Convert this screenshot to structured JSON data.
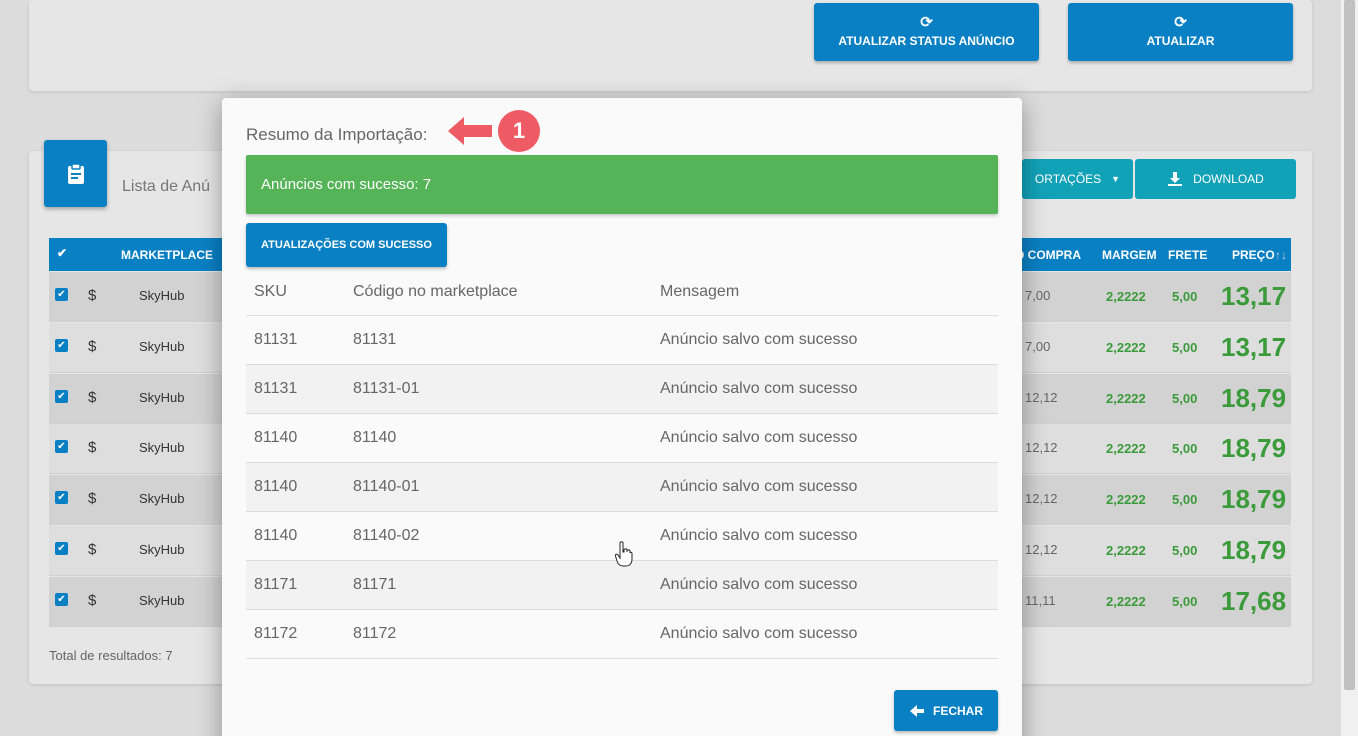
{
  "top_buttons": {
    "update_status_label": "ATUALIZAR STATUS ANÚNCIO",
    "update_label": "ATUALIZAR"
  },
  "list": {
    "title": "Lista de Anú",
    "importations_label": "ORTAÇÕES",
    "download_label": "DOWNLOAD",
    "columns": {
      "marketplace": "MARKETPLACE",
      "compra": "O COMPRA",
      "margem": "MARGEM",
      "frete": "FRETE",
      "preco": "PREÇO"
    },
    "rows": [
      {
        "marketplace": "SkyHub",
        "compra": "7,00",
        "margem": "2,2222",
        "frete": "5,00",
        "preco": "13,17"
      },
      {
        "marketplace": "SkyHub",
        "compra": "7,00",
        "margem": "2,2222",
        "frete": "5,00",
        "preco": "13,17"
      },
      {
        "marketplace": "SkyHub",
        "compra": "12,12",
        "margem": "2,2222",
        "frete": "5,00",
        "preco": "18,79"
      },
      {
        "marketplace": "SkyHub",
        "compra": "12,12",
        "margem": "2,2222",
        "frete": "5,00",
        "preco": "18,79"
      },
      {
        "marketplace": "SkyHub",
        "compra": "12,12",
        "margem": "2,2222",
        "frete": "5,00",
        "preco": "18,79"
      },
      {
        "marketplace": "SkyHub",
        "compra": "12,12",
        "margem": "2,2222",
        "frete": "5,00",
        "preco": "18,79"
      },
      {
        "marketplace": "SkyHub",
        "compra": "11,11",
        "margem": "2,2222",
        "frete": "5,00",
        "preco": "17,68"
      }
    ],
    "total": "Total de resultados: 7"
  },
  "modal": {
    "title": "Resumo da Importação:",
    "annotation_number": "1",
    "alert": "Anúncios com sucesso: 7",
    "success_button": "ATUALIZAÇÕES COM SUCESSO",
    "columns": {
      "sku": "SKU",
      "code": "Código no marketplace",
      "message": "Mensagem"
    },
    "rows": [
      {
        "sku": "81131",
        "code": "81131",
        "message": "Anúncio salvo com sucesso"
      },
      {
        "sku": "81131",
        "code": "81131-01",
        "message": "Anúncio salvo com sucesso"
      },
      {
        "sku": "81140",
        "code": "81140",
        "message": "Anúncio salvo com sucesso"
      },
      {
        "sku": "81140",
        "code": "81140-01",
        "message": "Anúncio salvo com sucesso"
      },
      {
        "sku": "81140",
        "code": "81140-02",
        "message": "Anúncio salvo com sucesso"
      },
      {
        "sku": "81171",
        "code": "81171",
        "message": "Anúncio salvo com sucesso"
      },
      {
        "sku": "81172",
        "code": "81172",
        "message": "Anúncio salvo com sucesso"
      }
    ],
    "close_label": "FECHAR"
  },
  "colors": {
    "primary": "#0a80c4",
    "success": "#55b358",
    "info": "#12a2b8",
    "badge": "#ef5b64",
    "value_green": "#3b9b3b"
  },
  "icons": {
    "refresh": "refresh-icon",
    "clipboard": "clipboard-icon",
    "download": "download-icon",
    "arrow_left": "arrow-left-icon",
    "cursor": "hand-cursor-icon"
  }
}
